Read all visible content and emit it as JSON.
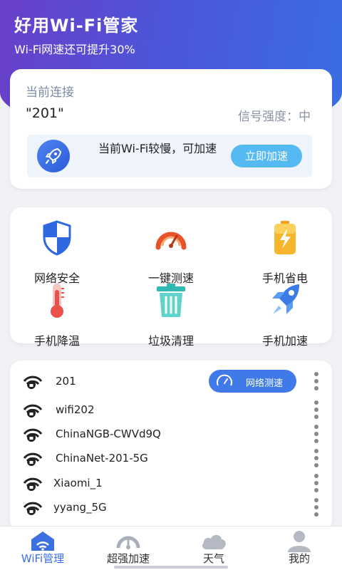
{
  "header": {
    "title": "好用Wi-Fi管家",
    "subtitle": "Wi-Fi网速还可提升30%"
  },
  "connection": {
    "label": "当前连接",
    "ssid": "\"201\"",
    "signal": "信号强度：中",
    "boost_message": "当前Wi-Fi较慢，可加速",
    "boost_button": "立即加速"
  },
  "tools": [
    {
      "label": "网络安全",
      "icon": "shield-icon"
    },
    {
      "label": "一键测速",
      "icon": "speedometer-icon"
    },
    {
      "label": "手机省电",
      "icon": "battery-icon"
    },
    {
      "label": "手机降温",
      "icon": "thermometer-icon"
    },
    {
      "label": "垃圾清理",
      "icon": "trash-icon"
    },
    {
      "label": "手机加速",
      "icon": "rocket-icon"
    }
  ],
  "wifi_list": {
    "speedtest_button": "网络测速",
    "networks": [
      {
        "name": "201"
      },
      {
        "name": "wifi202"
      },
      {
        "name": "ChinaNGB-CWVd9Q"
      },
      {
        "name": "ChinaNet-201-5G"
      },
      {
        "name": "Xiaomi_1"
      },
      {
        "name": "yyang_5G"
      }
    ]
  },
  "tabs": [
    {
      "label": "WiFi管理",
      "icon": "wifi-home-icon",
      "active": true
    },
    {
      "label": "超强加速",
      "icon": "speed-gauge-icon",
      "active": false
    },
    {
      "label": "天气",
      "icon": "cloud-icon",
      "active": false
    },
    {
      "label": "我的",
      "icon": "user-icon",
      "active": false
    }
  ],
  "colors": {
    "header_start": "#6a3fc9",
    "header_end": "#3a6ee3",
    "accent": "#3f7ae8",
    "boost_button": "#55b9f2",
    "active_tab": "#3c6fe0"
  }
}
